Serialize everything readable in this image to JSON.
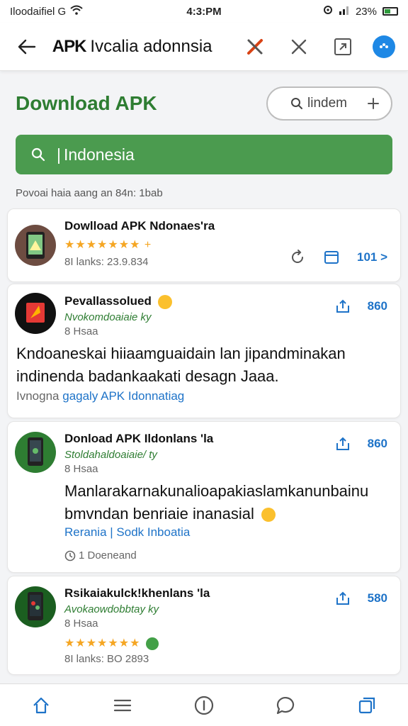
{
  "status_bar": {
    "left_text": "Iloodaifiel G",
    "time": "4:3:PM",
    "battery": "23%"
  },
  "top_bar": {
    "title_bold": "APK",
    "title_rest": "Ivcalia adonnsia"
  },
  "header": {
    "title": "Download APK",
    "login_label": "lindem"
  },
  "search": {
    "value": "Indonesia"
  },
  "result_info": "Povoai haia aang an 84n: 1bab",
  "cards": [
    {
      "title": "Dowlload APK Ndonaes'ra",
      "rating": "★★★★★★★ +",
      "meta": "8I lanks: 23.9.834",
      "count": "101 >"
    },
    {
      "title": "Pevallassolued",
      "subtitle": "Nvokomdoaiaie ky",
      "meta": "8 Hsaa",
      "body": "Kndoaneskai hiiaamguaidain lan jipandminakan indinenda badankaakati desagn Jaaa.",
      "link_prefix": "Ivnogna",
      "link_text": "gagaly APK Idonnatiag",
      "count": "860"
    },
    {
      "title": "Donload APK Ildonlans 'la",
      "subtitle": "Stoldahaldoaiaie/ ty",
      "meta": "8 Hsaa",
      "body": "Manlarakarnakunalioapakiaslamkanunbainu bmvndan benriaie inanasial",
      "link_text": "Rerania | Sodk Inboatia",
      "footer": "1 Doeneand",
      "count": "860"
    },
    {
      "title": "Rsikaiakulck!khenlans 'la",
      "subtitle": "Avokaowdobbtay ky",
      "meta": "8 Hsaa",
      "rating": "★★★★★★★",
      "meta2": "8I lanks: BO 2893",
      "count": "580"
    }
  ]
}
